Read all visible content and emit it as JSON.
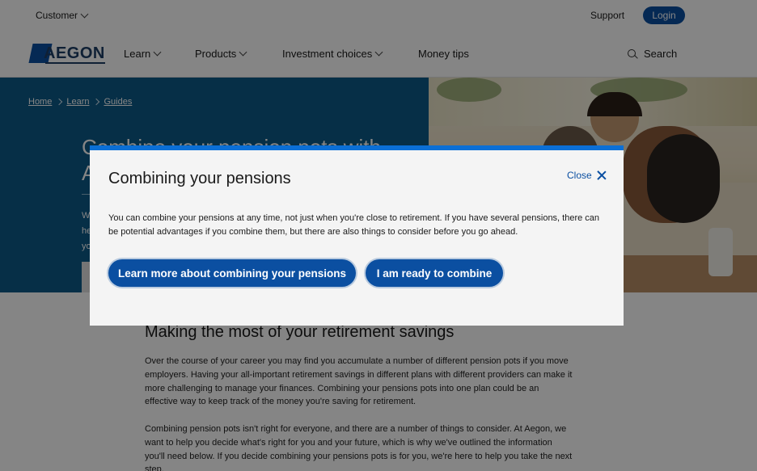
{
  "topbar": {
    "customer_label": "Customer",
    "support_label": "Support",
    "login_label": "Login"
  },
  "nav": {
    "logo_text": "AEGON",
    "items": [
      {
        "label": "Learn",
        "has_dropdown": true
      },
      {
        "label": "Products",
        "has_dropdown": true
      },
      {
        "label": "Investment choices",
        "has_dropdown": true
      },
      {
        "label": "Money tips",
        "has_dropdown": false
      }
    ],
    "search_label": "Search"
  },
  "breadcrumb": [
    "Home",
    "Learn",
    "Guides"
  ],
  "hero": {
    "title": "Combine your pension pots with Aegon",
    "intro": "We can help you decide if combining your pensions is right for you."
  },
  "article": {
    "title": "Making the most of your retirement savings",
    "paragraphs": [
      "Over the course of your career you may find you accumulate a number of different pension pots if you move employers. Having your all-important retirement savings in different plans with different providers can make it more challenging to manage your finances. Combining your pensions pots into one plan could be an effective way to keep track of the money you're saving for retirement.",
      "Combining pension pots isn't right for everyone, and there are a number of things to consider. At Aegon, we want to help you decide what's right for you and your future, which is why we've outlined the information you'll need below. If you decide combining your pensions pots is for you, we're here to help you take the next step."
    ]
  },
  "modal": {
    "title": "Combining your pensions",
    "close_label": "Close",
    "body": "You can combine your pensions at any time, not just when you're close to retirement. If you have several pensions, there can be potential advantages if you combine them, but there are also things to consider before you go ahead.",
    "primary_button": "Learn more about combining your pensions",
    "secondary_button": "I am ready to combine"
  },
  "colors": {
    "brand_blue": "#0b4fa1",
    "hero_blue": "#0d5b88",
    "modal_accent": "#0b6fd6"
  }
}
